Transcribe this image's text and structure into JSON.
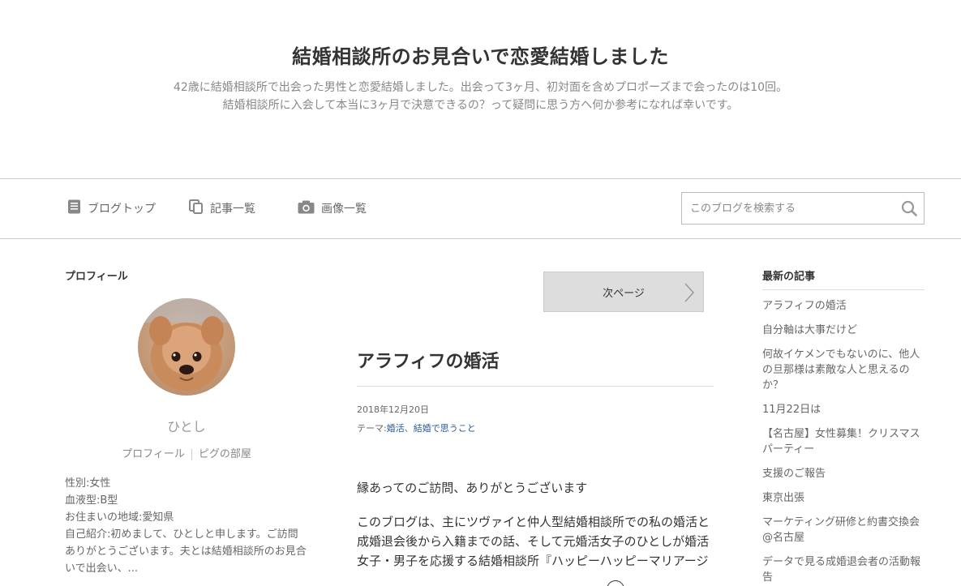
{
  "header": {
    "title": "結婚相談所のお見合いで恋愛結婚しました",
    "description_line1": "42歳に結婚相談所で出会った男性と恋愛結婚しました。出会って3ヶ月、初対面を含めプロポーズまで会ったのは10回。",
    "description_line2": "結婚相談所に入会して本当に3ヶ月で決意できるの？って疑問に思う方へ何か参考になれば幸いです。"
  },
  "nav": {
    "blog_top": "ブログトップ",
    "article_list": "記事一覧",
    "image_list": "画像一覧"
  },
  "search": {
    "placeholder": "このブログを検索する"
  },
  "profile": {
    "heading": "プロフィール",
    "nickname": "ひとし",
    "link_profile": "プロフィール",
    "link_room": "ピグの部屋",
    "gender": "性別:女性",
    "blood": "血液型:B型",
    "area": "お住まいの地域:愛知県",
    "intro": "自己紹介:初めまして、ひとしと申します。ご訪問ありがとうございます。夫とは結婚相談所のお見合いで出会い、..."
  },
  "main": {
    "next_page": "次ページ",
    "post_title": "アラフィフの婚活",
    "date": "2018年12月20日",
    "theme_label": "テーマ:",
    "theme_1": "婚活",
    "theme_sep": "、",
    "theme_2": "結婚で思うこと",
    "para1": "縁あってのご訪問、ありがとうございます",
    "para2": "このブログは、主にツヴァイと仲人型結婚相談所での私の婚活と成婚退会後から入籍までの話、そして元婚活女子のひとしが婚活女子・男子を応援する結婚相談所『ハッピーハッピーマリアージ"
  },
  "recent": {
    "heading": "最新の記事",
    "items": [
      "アラフィフの婚活",
      "自分軸は大事だけど",
      "何故イケメンでもないのに、他人の旦那様は素敵な人と思えるのか？",
      "11月22日は",
      "【名古屋】女性募集！クリスマスパーティー",
      "支援のご報告",
      "東京出張",
      "マーケティング研修と約書交換会@名古屋",
      "データで見る成婚退会者の活動報告"
    ]
  },
  "icons": {
    "blog_top": "document-icon",
    "article_list": "copy-icon",
    "image_list": "camera-icon",
    "search": "search-icon",
    "next": "chevron-right-icon"
  }
}
